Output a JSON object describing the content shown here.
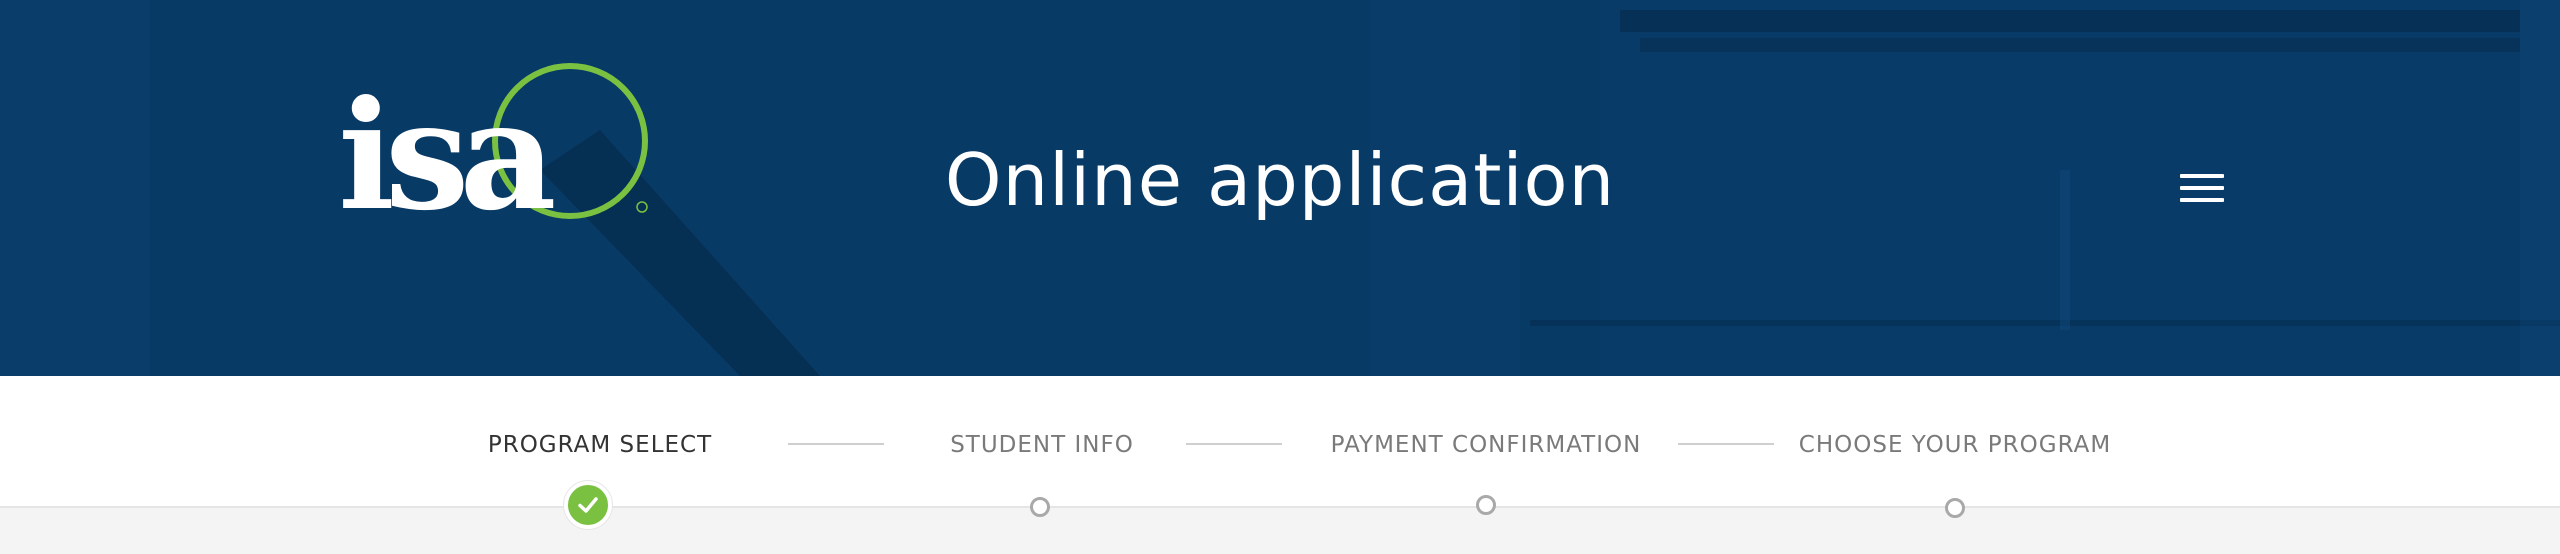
{
  "header": {
    "logo_text": "isa",
    "title": "Online application",
    "menu_icon": "hamburger-menu-icon",
    "background_color": "#083a66",
    "logo_ring_color": "#7ac142"
  },
  "steps": [
    {
      "label": "PROGRAM SELECT",
      "status": "complete"
    },
    {
      "label": "STUDENT INFO",
      "status": "pending"
    },
    {
      "label": "PAYMENT CONFIRMATION",
      "status": "pending"
    },
    {
      "label": "CHOOSE YOUR PROGRAM",
      "status": "pending"
    }
  ],
  "colors": {
    "accent_green": "#7ac142",
    "step_active_text": "#333333",
    "step_inactive_text": "#7a7a7a"
  }
}
